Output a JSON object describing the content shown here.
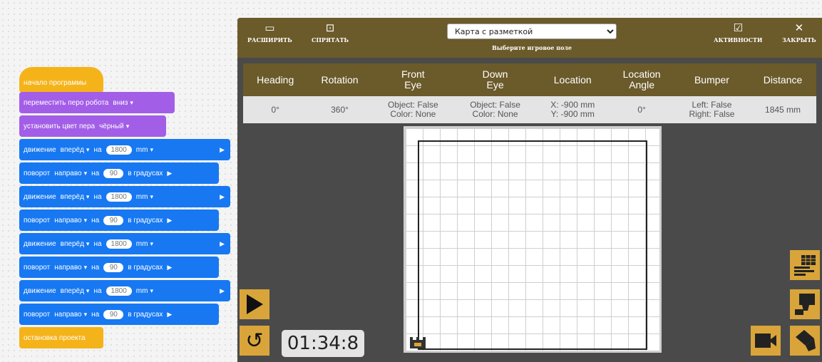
{
  "blocks": {
    "start": "начало программы",
    "pen_move": {
      "label": "переместить перо робота",
      "value": "вниз"
    },
    "pen_color": {
      "label": "установить цвет пера",
      "value": "чёрный"
    },
    "move": {
      "label": "движение",
      "direction": "вперёд",
      "on": "на",
      "amount": "1800",
      "unit": "mm"
    },
    "turn": {
      "label": "поворот",
      "direction": "направо",
      "on": "на",
      "amount": "90",
      "unit": "в градусах"
    },
    "stop": "остановка проекта"
  },
  "toolbar": {
    "expand": "РАСШИРИТЬ",
    "hide": "СПРЯТАТЬ",
    "field_selected": "Карта с разметкой",
    "field_hint": "Выберите игровое поле",
    "activities": "АКТИВНОСТИ",
    "close": "ЗАКРЫТЬ"
  },
  "telemetry": {
    "headers": [
      "Heading",
      "Rotation",
      "Front\nEye",
      "Down\nEye",
      "Location",
      "Location\nAngle",
      "Bumper",
      "Distance"
    ],
    "values": [
      "0°",
      "360°",
      "Object: False\nColor: None",
      "Object: False\nColor: None",
      "X: -900 mm\nY: -900 mm",
      "0°",
      "Left: False\nRight: False",
      "1845 mm"
    ]
  },
  "timer": "01:34:8",
  "colors": {
    "hat": "#f5b31a",
    "pen": "#a35ee8",
    "motion": "#1778f2",
    "toolbar": "#6b5a2a",
    "button": "#d9a53a"
  }
}
